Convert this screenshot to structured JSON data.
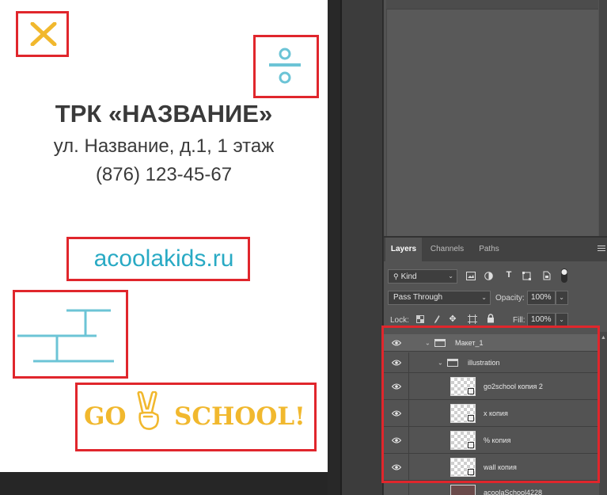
{
  "canvas": {
    "title": "ТРК «НАЗВАНИЕ»",
    "address": "ул. Название, д.1, 1 этаж",
    "phone": "(876) 123-45-67",
    "website": "acoolakids.ru",
    "go_word": "GO",
    "school_word": "SCHOOL!",
    "x_symbol": "✕",
    "colors": {
      "yellow": "#f1b82e",
      "teal": "#6cc4d6",
      "dark_text": "#3a3a3a",
      "frame_red": "#e0262c"
    }
  },
  "panel": {
    "tabs": [
      {
        "label": "Layers"
      },
      {
        "label": "Channels"
      },
      {
        "label": "Paths"
      }
    ],
    "filter": {
      "label": "Kind",
      "icons": [
        "image-filter-icon",
        "adjustment-filter-icon",
        "type-filter-icon",
        "shape-filter-icon",
        "smart-object-filter-icon",
        "toggle-filter-icon"
      ]
    },
    "blend_mode": "Pass Through",
    "opacity": {
      "label": "Opacity:",
      "value": "100%"
    },
    "lock": {
      "label": "Lock:"
    },
    "fill": {
      "label": "Fill:",
      "value": "100%"
    },
    "layers": [
      {
        "name": "Макет_1",
        "type": "group",
        "expanded": true,
        "selected": true
      },
      {
        "name": "illustration",
        "type": "group",
        "expanded": true,
        "selected": false
      },
      {
        "name": "go2school копия 2",
        "type": "smart-object",
        "selected": false
      },
      {
        "name": "x копия",
        "type": "smart-object",
        "selected": false
      },
      {
        "name": "% копия",
        "type": "smart-object",
        "selected": false
      },
      {
        "name": "wall копия",
        "type": "smart-object",
        "selected": false
      }
    ],
    "partial_layer_name": "acoolaSchool4228"
  }
}
